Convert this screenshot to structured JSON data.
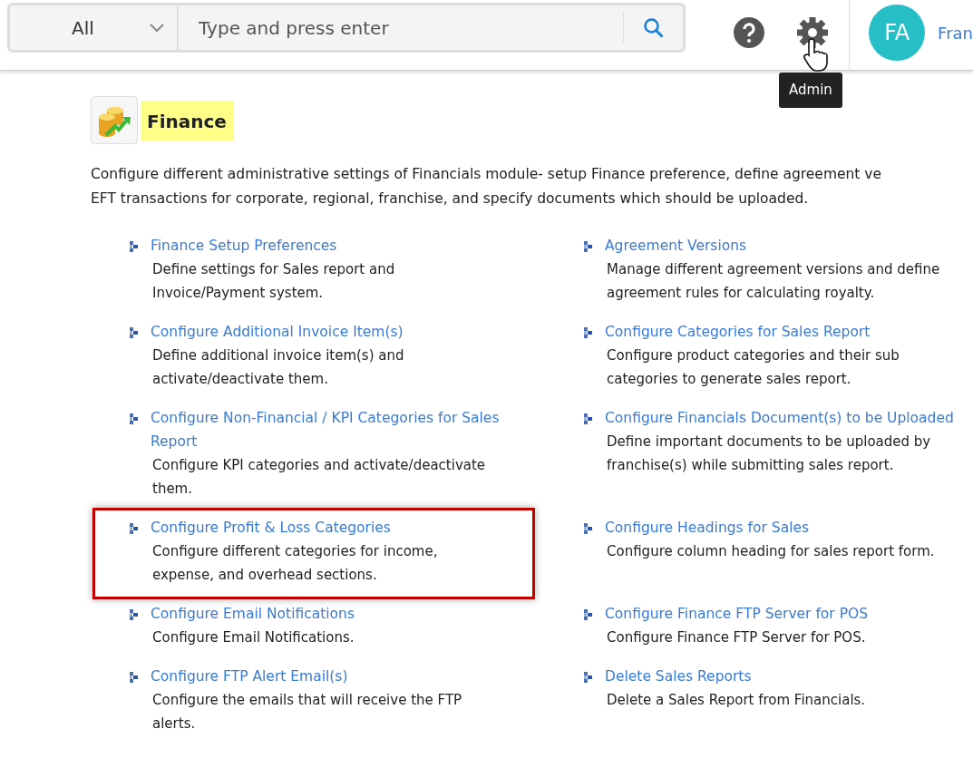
{
  "header": {
    "search": {
      "scope": "All",
      "placeholder": "Type and press enter"
    },
    "tooltip": "Admin",
    "user": {
      "initials": "FA",
      "name": "Fran"
    }
  },
  "module": {
    "title": "Finance",
    "description_lines": [
      "Configure different administrative settings of Financials module- setup Finance preference, define agreement ve",
      "EFT transactions for corporate, regional, franchise, and specify documents which should be uploaded."
    ]
  },
  "links": [
    {
      "title": "Finance Setup Preferences",
      "description": "Define settings for Sales report and Invoice/Payment system.",
      "highlighted": false
    },
    {
      "title": "Agreement Versions",
      "description": "Manage different agreement versions and define agreement rules for calculating royalty.",
      "highlighted": false
    },
    {
      "title": "Configure Additional Invoice Item(s)",
      "description": "Define additional invoice item(s) and activate/deactivate them.",
      "highlighted": false
    },
    {
      "title": "Configure Categories for Sales Report",
      "description": "Configure product categories and their sub categories to generate sales report.",
      "highlighted": false
    },
    {
      "title": "Configure Non-Financial / KPI Categories for Sales Report",
      "description": "Configure KPI categories and activate/deactivate them.",
      "highlighted": false
    },
    {
      "title": "Configure Financials Document(s) to be Uploaded",
      "description": "Define important documents to be uploaded by franchise(s) while submitting sales report.",
      "highlighted": false
    },
    {
      "title": "Configure Profit & Loss Categories",
      "description": "Configure different categories for income, expense, and overhead sections.",
      "highlighted": true
    },
    {
      "title": "Configure Headings for Sales",
      "description": "Configure column heading for sales report form.",
      "highlighted": false
    },
    {
      "title": "Configure Email Notifications",
      "description": "Configure Email Notifications.",
      "highlighted": false
    },
    {
      "title": "Configure Finance FTP Server for POS",
      "description": "Configure Finance FTP Server for POS.",
      "highlighted": false
    },
    {
      "title": "Configure FTP Alert Email(s)",
      "description": "Configure the emails that will receive the FTP alerts.",
      "highlighted": false
    },
    {
      "title": "Delete Sales Reports",
      "description": "Delete a Sales Report from Financials.",
      "highlighted": false
    }
  ]
}
